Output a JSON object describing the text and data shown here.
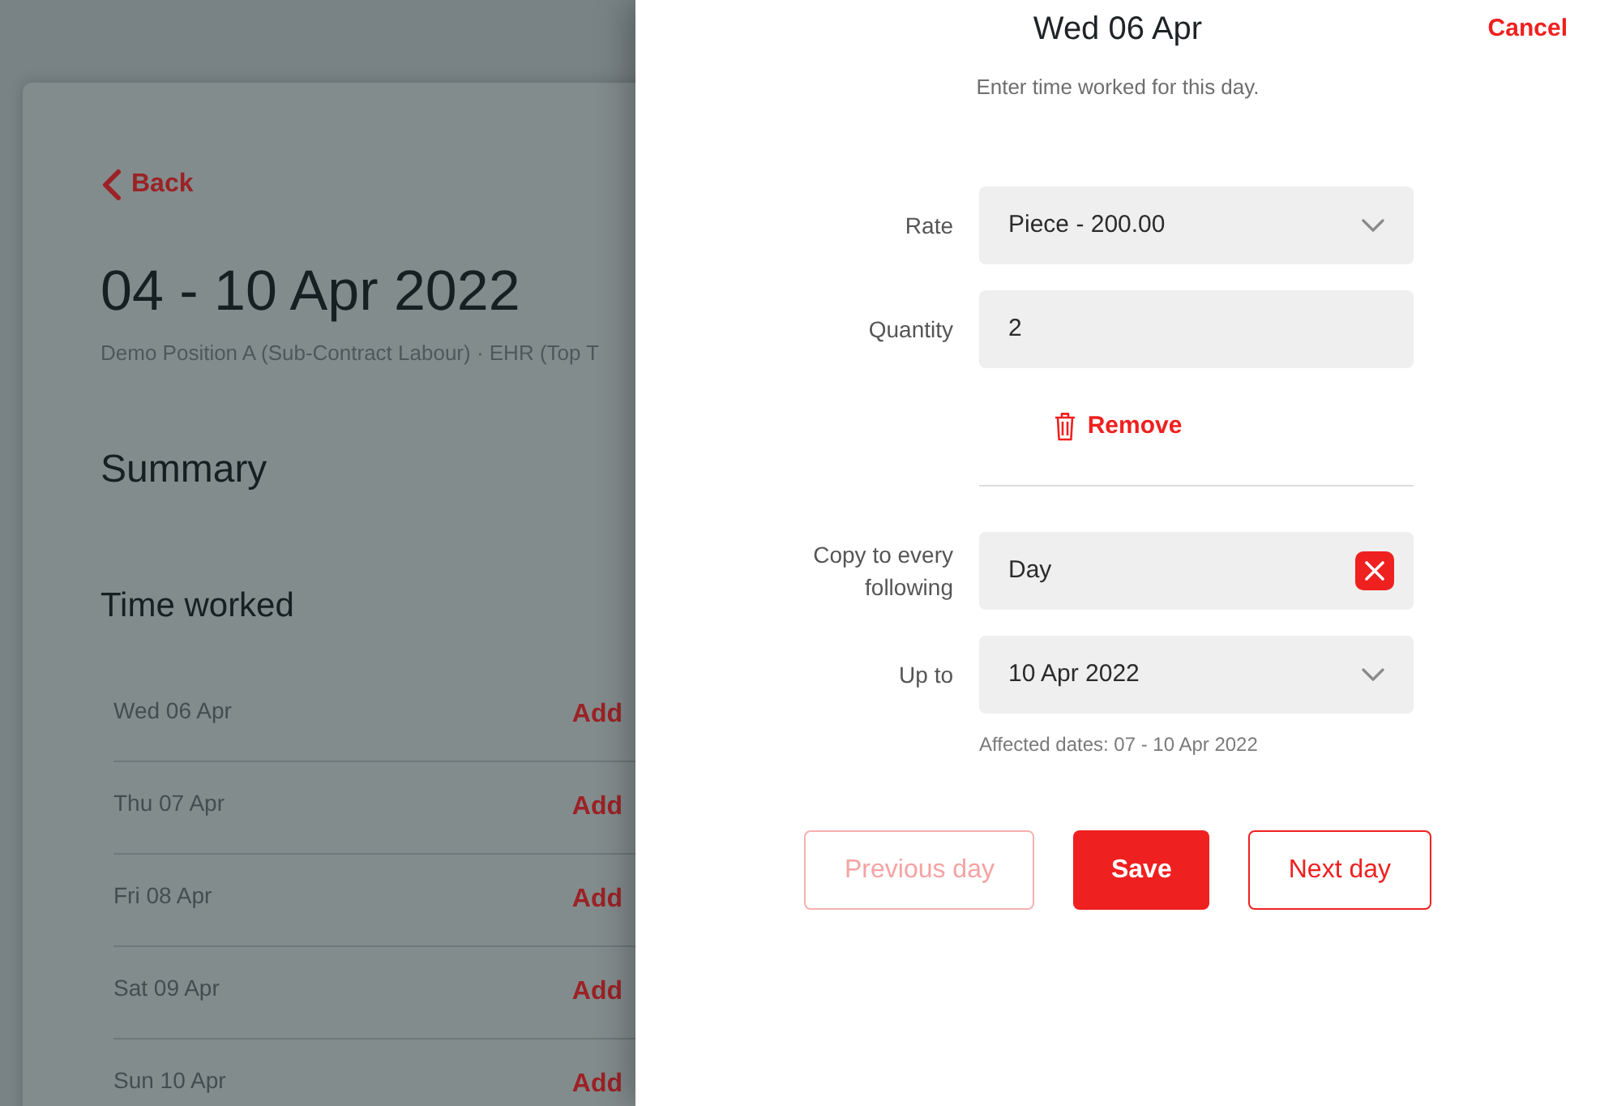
{
  "page": {
    "back_link": "Back",
    "title": "04 - 10 Apr 2022",
    "subtitle": "Demo Position A (Sub-Contract Labour) · EHR (Top T",
    "summary_heading": "Summary",
    "time_worked_heading": "Time worked",
    "days": [
      {
        "date": "Wed 06 Apr",
        "action": "Add"
      },
      {
        "date": "Thu 07 Apr",
        "action": "Add"
      },
      {
        "date": "Fri 08 Apr",
        "action": "Add"
      },
      {
        "date": "Sat 09 Apr",
        "action": "Add"
      },
      {
        "date": "Sun 10 Apr",
        "action": "Add"
      }
    ]
  },
  "drawer": {
    "title": "Wed 06 Apr",
    "cancel": "Cancel",
    "instruction": "Enter time worked for this day.",
    "fields": [
      {
        "label": "Rate",
        "kind": "select",
        "value": "Piece - 200.00"
      },
      {
        "label": "Quantity",
        "kind": "input",
        "value": "2"
      }
    ],
    "remove": "Remove",
    "copy_fields": [
      {
        "label": "Copy to every following",
        "kind": "clearable",
        "value": "Day"
      },
      {
        "label": "Up to",
        "kind": "select",
        "value": "10 Apr 2022",
        "hint": "Affected dates: 07 - 10 Apr 2022"
      }
    ],
    "buttons": [
      {
        "label": "Previous day",
        "kind": "outline",
        "disabled": true
      },
      {
        "label": "Save",
        "kind": "primary",
        "disabled": false
      },
      {
        "label": "Next day",
        "kind": "outline",
        "disabled": false
      }
    ]
  }
}
